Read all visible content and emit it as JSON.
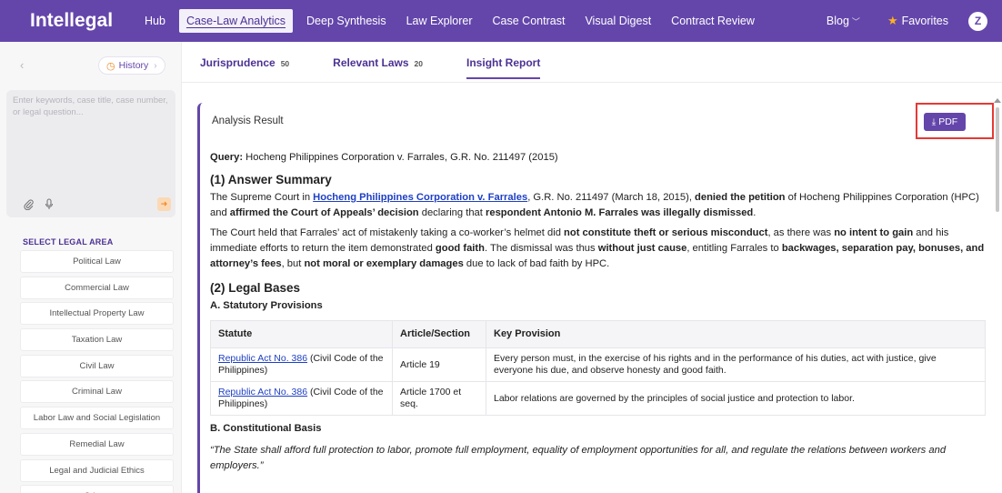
{
  "app": {
    "logo": "Intellegal"
  },
  "nav": {
    "items": [
      {
        "label": "Hub"
      },
      {
        "label": "Case-Law Analytics",
        "active": true
      },
      {
        "label": "Deep Synthesis"
      },
      {
        "label": "Law Explorer"
      },
      {
        "label": "Case Contrast"
      },
      {
        "label": "Visual Digest"
      },
      {
        "label": "Contract Review"
      }
    ],
    "blog": "Blog",
    "favorites": "Favorites",
    "avatar_initial": "Z"
  },
  "sidebar": {
    "history_label": "History",
    "search_placeholder": "Enter keywords, case title, case number, or legal question...",
    "area_title": "SELECT LEGAL AREA",
    "areas": [
      "Political Law",
      "Commercial Law",
      "Intellectual Property Law",
      "Taxation Law",
      "Civil Law",
      "Criminal Law",
      "Labor Law and Social Legislation",
      "Remedial Law",
      "Legal and Judicial Ethics",
      "Others"
    ]
  },
  "tabs": [
    {
      "label": "Jurisprudence",
      "count": "50"
    },
    {
      "label": "Relevant Laws",
      "count": "20"
    },
    {
      "label": "Insight Report",
      "count": "",
      "active": true
    }
  ],
  "report": {
    "header_label": "Analysis Result",
    "pdf_label": "PDF",
    "query_label": "Query:",
    "query_text": " Hocheng Philippines Corporation v. Farrales, G.R. No. 211497 (2015)",
    "section1_title": "(1) Answer Summary",
    "p1": {
      "t1": "The Supreme Court in ",
      "link": "Hocheng Philippines Corporation v. Farrales",
      "t2": ", G.R. No. 211497 (March 18, 2015), ",
      "b1": "denied the petition",
      "t3": " of Hocheng Philippines Corporation (HPC) and ",
      "b2": "affirmed the Court of Appeals’ decision",
      "t4": " declaring that ",
      "b3": "respondent Antonio M. Farrales was illegally dismissed",
      "t5": "."
    },
    "p2": {
      "t1": "The Court held that Farrales’ act of mistakenly taking a co-worker’s helmet did ",
      "b1": "not constitute theft or serious misconduct",
      "t2": ", as there was ",
      "b2": "no intent to gain",
      "t3": " and his immediate efforts to return the item demonstrated ",
      "b3": "good faith",
      "t4": ". The dismissal was thus ",
      "b4": "without just cause",
      "t5": ", entitling Farrales to ",
      "b5": "backwages, separation pay, bonuses, and attorney’s fees",
      "t6": ", but ",
      "b6": "not moral or exemplary damages",
      "t7": " due to lack of bad faith by HPC."
    },
    "section2_title": "(2) Legal Bases",
    "subA_title": "A. Statutory Provisions",
    "table": {
      "headers": [
        "Statute",
        "Article/Section",
        "Key Provision"
      ],
      "rows": [
        {
          "link": "Republic Act No. 386",
          "rest": " (Civil Code of the Philippines)",
          "article": "Article 19",
          "provision": "Every person must, in the exercise of his rights and in the performance of his duties, act with justice, give everyone his due, and observe honesty and good faith."
        },
        {
          "link": "Republic Act No. 386",
          "rest": " (Civil Code of the Philippines)",
          "article": "Article 1700 et seq.",
          "provision": "Labor relations are governed by the principles of social justice and protection to labor."
        }
      ]
    },
    "subB_title": "B. Constitutional Basis",
    "quote": "“The State shall afford full protection to labor, promote full employment, equality of employment opportunities for all, and regulate the relations between workers and employers.”"
  },
  "colors": {
    "brand": "#6446ab",
    "link": "#1e3fc4",
    "highlight": "#e53935",
    "accent": "#f08a2a"
  },
  "icons": [
    "back-icon",
    "clock-icon",
    "paperclip-icon",
    "mic-icon",
    "send-icon",
    "star-icon",
    "download-icon",
    "chevron-down-icon"
  ]
}
